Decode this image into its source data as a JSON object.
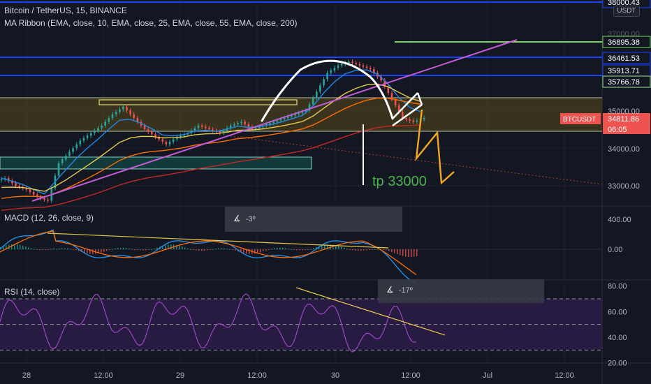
{
  "header": {
    "symbol_line": "Bitcoin / TetherUS, 15, BINANCE",
    "indicator_line": "MA Ribbon (EMA, close, 10, EMA, close, 25, EMA, close, 55, EMA, close, 200)",
    "currency_badge": "USDT"
  },
  "colors": {
    "background": "#131722",
    "candle_up": "#26a69a",
    "candle_down": "#ef5350",
    "level_blue": "#1e40ff",
    "green_line": "#7ed36b",
    "magenta": "#c25cd6",
    "orange": "#f5a623",
    "zone_fill": "#5a4a1c",
    "rsi_fill": "#3b1f5b",
    "rsi_line": "#9c46c4",
    "macd_line": "#2196f3",
    "signal_line": "#ff6d00",
    "trend_yellow": "#e6c84c"
  },
  "annotations": {
    "tp_label": "tp 33000",
    "macd_angle": "-3º",
    "rsi_angle": "-17º"
  },
  "chart_data": [
    {
      "type": "candlestick",
      "title": "Bitcoin / TetherUS, 15, BINANCE",
      "y_ticks": [
        "33000.00",
        "34000.00",
        "35000.00",
        "37000.00",
        "38000.00"
      ],
      "x_ticks": [
        "28",
        "12:00",
        "29",
        "12:00",
        "30",
        "12:00",
        "Jul",
        "12:00"
      ],
      "ylim": [
        32400,
        38100
      ],
      "price_labels": [
        {
          "value": "38000.43",
          "color": "#1e40ff"
        },
        {
          "value": "36895.38",
          "color": "#7ed36b"
        },
        {
          "value": "36461.53",
          "color": "#1e40ff"
        },
        {
          "value": "35913.71",
          "color": "#1e40ff"
        },
        {
          "value": "35766.78",
          "color": "#9fe0a0"
        },
        {
          "value": "34811.86",
          "color": "#ef5350"
        }
      ],
      "current": {
        "symbol": "BTCUSDT",
        "price": "34811.86",
        "countdown": "06:05"
      },
      "close_series": [
        33200,
        33000,
        32900,
        32700,
        32600,
        33600,
        33900,
        34200,
        34400,
        34600,
        34900,
        35100,
        34800,
        34500,
        34300,
        34100,
        34300,
        34400,
        34600,
        34500,
        34400,
        34600,
        34700,
        34500,
        34600,
        34700,
        34800,
        34900,
        35000,
        35500,
        36000,
        36200,
        36300,
        36200,
        36100,
        35800,
        35300,
        34800,
        34700,
        34800
      ],
      "series": [
        {
          "name": "EMA 10",
          "color": "#1e88e5"
        },
        {
          "name": "EMA 25",
          "color": "#e6c84c"
        },
        {
          "name": "EMA 55",
          "color": "#ff6d00"
        },
        {
          "name": "EMA 200",
          "color": "#c62828"
        }
      ]
    },
    {
      "type": "line",
      "title": "MACD (12, 26, close, 9)",
      "y_ticks": [
        "400.00",
        "0.00"
      ],
      "ylim": [
        -200,
        480
      ]
    },
    {
      "type": "line",
      "title": "RSI (14, close)",
      "y_ticks": [
        "80.00",
        "60.00",
        "40.00",
        "20.00"
      ],
      "ylim": [
        18,
        82
      ],
      "levels": [
        70,
        50,
        30
      ]
    }
  ]
}
